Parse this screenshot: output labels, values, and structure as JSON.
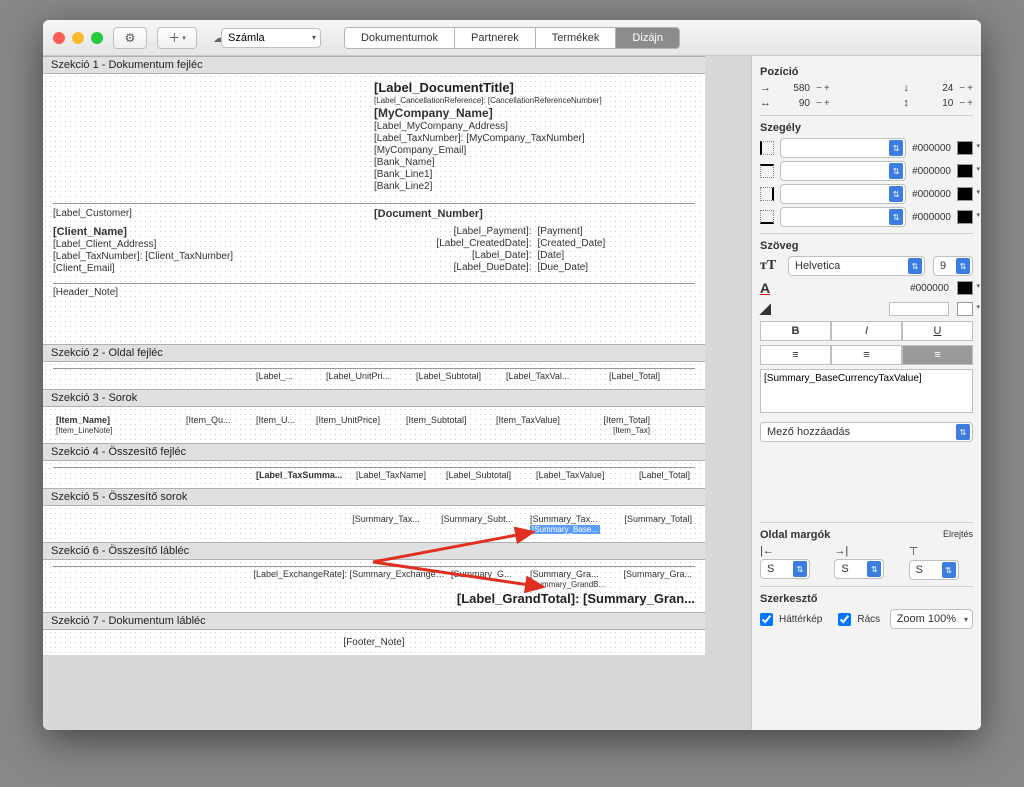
{
  "toolbar": {
    "tabs": [
      "Dokumentumok",
      "Partnerek",
      "Termékek",
      "Dizájn"
    ],
    "active_tab": "Dizájn",
    "doctype": "Számla"
  },
  "sections": {
    "s1": {
      "title": "Szekció 1 - Dokumentum fejléc",
      "doc_title": "[Label_DocumentTitle]",
      "cancel": "[Label_CancellationReference]: [CancellationReferenceNumber]",
      "company": "[MyCompany_Name]",
      "addr": "[Label_MyCompany_Address]",
      "tax": "[Label_TaxNumber]: [MyCompany_TaxNumber]",
      "email": "[MyCompany_Email]",
      "bank": "[Bank_Name]",
      "bank1": "[Bank_Line1]",
      "bank2": "[Bank_Line2]",
      "lbl_customer": "[Label_Customer]",
      "doc_number": "[Document_Number]",
      "client_name": "[Client_Name]",
      "client_addr": "[Label_Client_Address]",
      "client_tax": "[Label_TaxNumber]: [Client_TaxNumber]",
      "client_email": "[Client_Email]",
      "header_note": "[Header_Note]",
      "lbl_payment": "[Label_Payment]:",
      "payment": "[Payment]",
      "lbl_created": "[Label_CreatedDate]:",
      "created": "[Created_Date]",
      "lbl_date": "[Label_Date]:",
      "date": "[Date]",
      "lbl_due": "[Label_DueDate]:",
      "due": "[Due_Date]"
    },
    "s2": {
      "title": "Szekció 2 - Oldal fejléc",
      "cols": [
        "[Label_...",
        "[Label_UnitPri...",
        "[Label_Subtotal]",
        "[Label_TaxVal...",
        "[Label_Total]"
      ]
    },
    "s3": {
      "title": "Szekció 3 - Sorok",
      "name": "[Item_Name]",
      "note": "[Item_LineNote]",
      "cols": [
        "[Item_Qu...",
        "[Item_U...",
        "[Item_UnitPrice]",
        "[Item_Subtotal]",
        "[Item_TaxValue]",
        "[Item_Total]"
      ],
      "tax": "[Item_Tax]"
    },
    "s4": {
      "title": "Szekció 4 - Összesítő fejléc",
      "lbl": "[Label_TaxSumma...",
      "cols": [
        "[Label_TaxName]",
        "[Label_Subtotal]",
        "[Label_TaxValue]",
        "[Label_Total]"
      ]
    },
    "s5": {
      "title": "Szekció 5 - Összesítő sorok",
      "cols": [
        "[Summary_Tax...",
        "[Summary_Subt...",
        "[Summary_Tax...",
        "[Summary_Total]"
      ],
      "base": "[Summary_Base..."
    },
    "s6": {
      "title": "Szekció 6 - Összesítő lábléc",
      "ex": "[Label_ExchangeRate]: [Summary_ExchangeRate]",
      "cols": [
        "[Summary_G...",
        "[Summary_Gra...",
        "[Summary_Gra..."
      ],
      "gb": "[Summary_GrandB...",
      "grand": "[Label_GrandTotal]: [Summary_Gran..."
    },
    "s7": {
      "title": "Szekció 7 - Dokumentum lábléc",
      "footer": "[Footer_Note]"
    }
  },
  "inspector": {
    "pozicio": {
      "label": "Pozíció",
      "x": "580",
      "y": "24",
      "w": "90",
      "h": "10"
    },
    "szegely": {
      "label": "Szegély",
      "color": "#000000"
    },
    "szoveg": {
      "label": "Szöveg",
      "font": "Helvetica",
      "size": "9",
      "color": "#000000",
      "content": "[Summary_BaseCurrencyTaxValue]",
      "add_field": "Mező hozzáadás"
    },
    "margok": {
      "label": "Oldal margók",
      "hide": "Elrejtés",
      "left": "S",
      "right": "S",
      "top": "S"
    },
    "szerk": {
      "label": "Szerkesztő",
      "bg": "Háttérkép",
      "grid": "Rács",
      "zoom": "Zoom 100%"
    }
  }
}
